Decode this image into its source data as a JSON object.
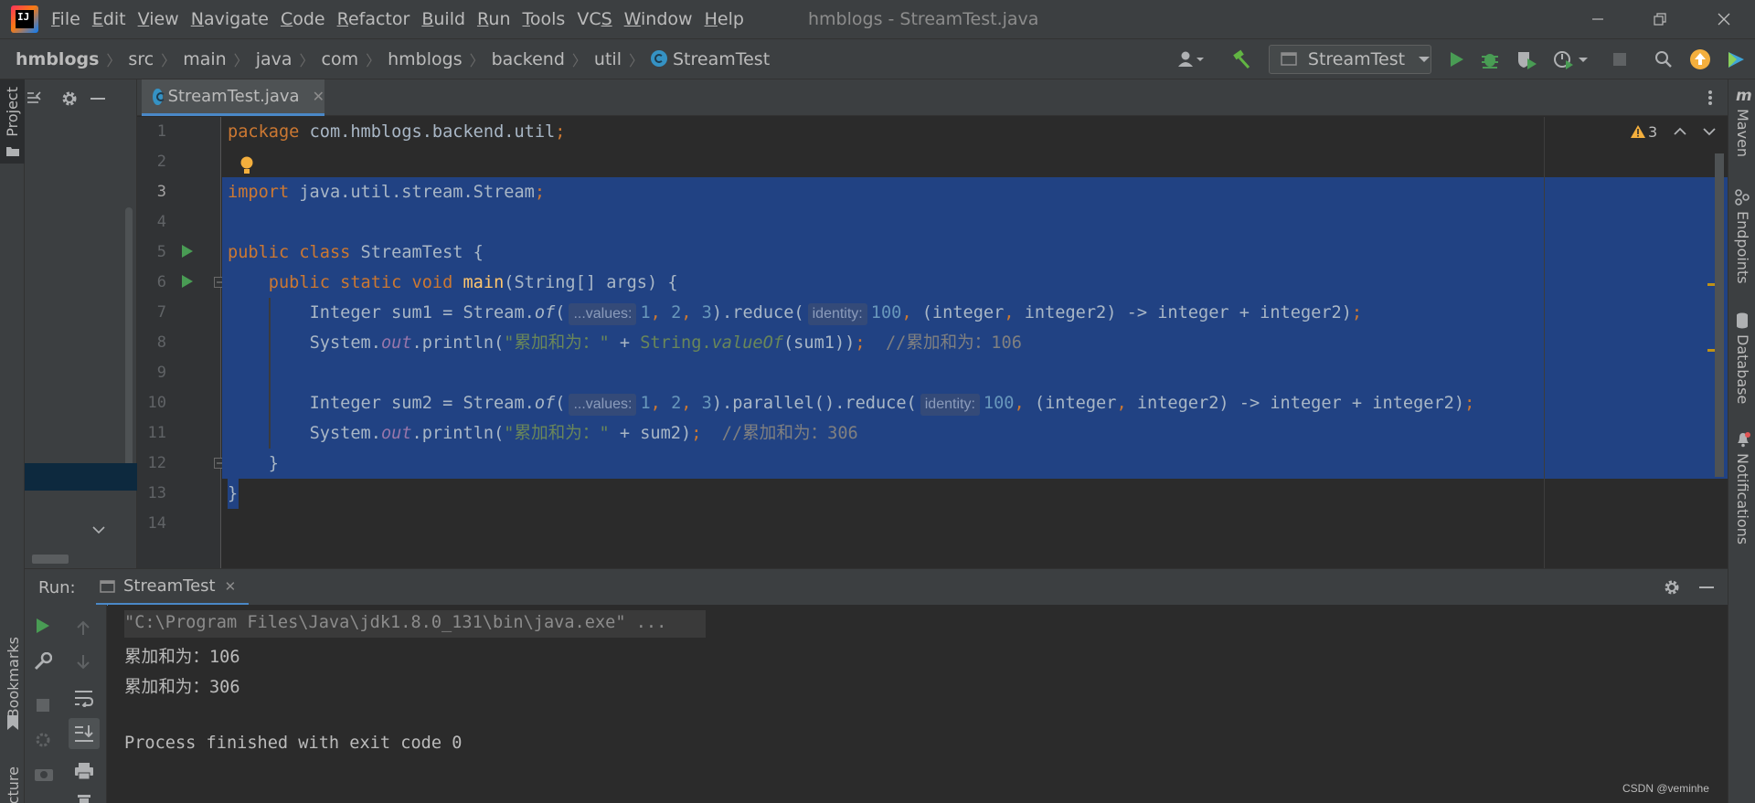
{
  "menu": {
    "items": [
      "File",
      "Edit",
      "View",
      "Navigate",
      "Code",
      "Refactor",
      "Build",
      "Run",
      "Tools",
      "VCS",
      "Window",
      "Help"
    ],
    "mnemonic": [
      "F",
      "E",
      "V",
      "N",
      "C",
      "R",
      "B",
      "R",
      "T",
      "S",
      "W",
      "H"
    ]
  },
  "window": {
    "title": "hmblogs - StreamTest.java"
  },
  "breadcrumb": {
    "root": "hmblogs",
    "items": [
      "src",
      "main",
      "java",
      "com",
      "hmblogs",
      "backend",
      "util"
    ],
    "class": "StreamTest"
  },
  "toolbar": {
    "run_config": "StreamTest"
  },
  "left_stripe": {
    "project": "Project",
    "bookmarks": "Bookmarks",
    "structure": "cture"
  },
  "right_stripe": {
    "maven": "Maven",
    "endpoints": "Endpoints",
    "database": "Database",
    "notifications": "Notifications"
  },
  "editor": {
    "tab": "StreamTest.java",
    "warnings": "3",
    "line_numbers": [
      "1",
      "2",
      "3",
      "4",
      "5",
      "6",
      "7",
      "8",
      "9",
      "10",
      "11",
      "12",
      "13",
      "14"
    ],
    "hints": {
      "values": "...values:",
      "identity": "identity:"
    },
    "code": {
      "l1_kw": "package",
      "l1_rest": " com.hmblogs.backend.util",
      "l1_semi": ";",
      "l3_kw": "import",
      "l3_rest": " java.util.stream.Stream",
      "l3_semi": ";",
      "l5_kw": "public class",
      "l5_rest": " StreamTest {",
      "l6_kw": "public static void",
      "l6_fn": "main",
      "l6_rest": "(String[] args) {",
      "l7_a": "Integer sum1 = Stream.",
      "l7_of": "of",
      "l7_b": "(",
      "l7_n1": "1",
      "l7_n2": "2",
      "l7_n3": "3",
      "l7_c": ").reduce(",
      "l7_id": "100",
      "l7_d": "(integer",
      "l7_e": " integer2) -> integer + integer2)",
      "l8_a": "System.",
      "l8_out": "out",
      "l8_b": ".println(",
      "l8_str": "\"累加和为：\"",
      "l8_c": " + ",
      "l8_sv": "String.",
      "l8_vo": "valueOf",
      "l8_d": "(sum1))",
      "l8_cmt": "//累加和为：106",
      "l10_a": "Integer sum2 = Stream.",
      "l10_of": "of",
      "l10_b": "(",
      "l10_n1": "1",
      "l10_n2": "2",
      "l10_n3": "3",
      "l10_c": ").parallel().reduce(",
      "l10_id": "100",
      "l10_d": "(integer",
      "l10_e": " integer2) -> integer + integer2)",
      "l11_a": "System.",
      "l11_out": "out",
      "l11_b": ".println(",
      "l11_str": "\"累加和为：\"",
      "l11_c": " + sum2)",
      "l11_cmt": "//累加和为：306",
      "l12": "}",
      "l13": "}"
    }
  },
  "run": {
    "label": "Run:",
    "tab": "StreamTest",
    "console": [
      "\"C:\\Program Files\\Java\\jdk1.8.0_131\\bin\\java.exe\" ...",
      "累加和为：106",
      "累加和为：306",
      "",
      "Process finished with exit code 0"
    ]
  },
  "watermark": "CSDN @veminhe",
  "colors": {
    "selection": "#214283",
    "keyword": "#cc7832",
    "number": "#6897bb",
    "string": "#6a8759",
    "comment": "#808080",
    "function": "#ffc66d",
    "field": "#9876aa"
  }
}
